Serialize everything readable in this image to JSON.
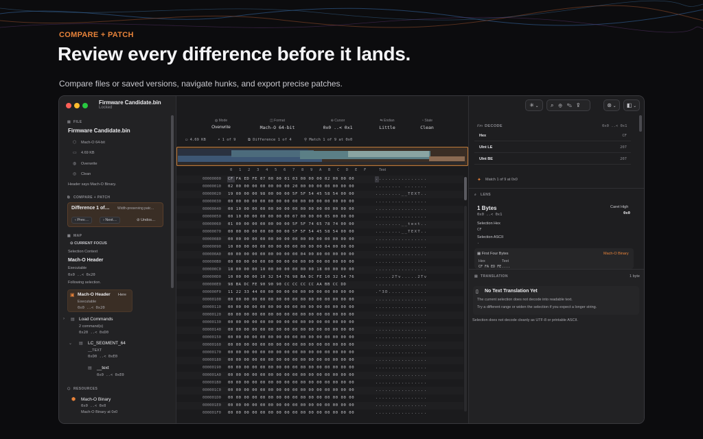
{
  "hero": {
    "kicker": "COMPARE + PATCH",
    "title": "Review every difference before it lands.",
    "subtitle": "Compare files or saved versions, navigate hunks, and export precise patches."
  },
  "colors": {
    "accent": "#e8833a",
    "window_bg": "#1b1b1d",
    "sidebar_bg": "#222224",
    "diff_highlight": "#3a2e25"
  },
  "window": {
    "doc_title": "Firmware Candidate.bin",
    "doc_subtitle": "Locked"
  },
  "sidebar": {
    "file_header": "FILE",
    "file_name": "Firmware Candidate.bin",
    "file_meta": [
      {
        "icon": "cube-icon",
        "text": "Mach-O 64-bit"
      },
      {
        "icon": "disk-icon",
        "text": "4.69 KB"
      },
      {
        "icon": "overwrite-icon",
        "text": "Overwrite"
      },
      {
        "icon": "check-icon",
        "text": "Clean"
      }
    ],
    "file_note": "Header says Mach-O Binary.",
    "compare_header": "COMPARE + PATCH",
    "compare_title": "Difference 1 of…",
    "compare_hint": "Width-preserving patc…",
    "prev_label": "Prev…",
    "next_label": "Next…",
    "undo_label": "Undos…",
    "map_header": "MAP",
    "current_focus": "CURRENT FOCUS",
    "selection_context_label": "Selection Context",
    "focus_title": "Mach-O Header",
    "focus_kind": "Executable",
    "focus_range": "0x0 ..< 0x20",
    "following": "Following selection.",
    "card_title": "Mach-O Header",
    "card_here": "Here",
    "card_kind": "Executable",
    "card_range": "0x0 ..< 0x20",
    "load_commands": "Load Commands",
    "load_commands_count": "2 command(s)",
    "load_commands_range": "0x20 ..< 0xD0",
    "segment": "LC_SEGMENT_64",
    "segment_name": "__TEXT",
    "segment_range": "0xD0 ..< 0xE0",
    "section": "__text",
    "section_range": "0x0 ..< 0xE0",
    "resources_header": "RESOURCES",
    "resource_title": "Mach-O Binary",
    "resource_range": "0x0 ..< 0x0",
    "resource_note": "Mach-O Binary at 0x0"
  },
  "infobar": [
    {
      "key": "Mode",
      "value": "Overwrite",
      "icon": "overwrite-icon"
    },
    {
      "key": "Format",
      "value": "Mach-O 64-bit",
      "icon": "format-icon"
    },
    {
      "key": "Cursor",
      "value": "0x0 ..< 0x1",
      "icon": "cursor-icon"
    },
    {
      "key": "Endian",
      "value": "Little",
      "icon": "endian-icon"
    },
    {
      "key": "State",
      "value": "Clean",
      "icon": "state-icon"
    }
  ],
  "status": {
    "size": "4.69 KB",
    "search": "1 of 9",
    "difference": "Difference 1 of 4",
    "match": "Match 1 of 9 at 0x0"
  },
  "hex": {
    "columns": [
      "0",
      "1",
      "2",
      "3",
      "4",
      "5",
      "6",
      "7",
      "8",
      "9",
      "A",
      "B",
      "C",
      "D",
      "E",
      "F"
    ],
    "text_header": "Text",
    "rows": [
      {
        "off": "00000000",
        "bytes": "CF FA ED FE 07 00 00 01 03 00 00 00 02 00 00 00",
        "ascii": "................"
      },
      {
        "off": "00000010",
        "bytes": "02 00 00 00 00 00 00 00 20 00 00 00 00 00 00 00",
        "ascii": "........ ......."
      },
      {
        "off": "00000020",
        "bytes": "19 00 00 00 98 00 00 00 5F 5F 54 45 58 54 00 00",
        "ascii": "........__TEXT.."
      },
      {
        "off": "00000030",
        "bytes": "00 00 00 00 00 00 00 00 00 00 00 00 00 00 00 00",
        "ascii": "................"
      },
      {
        "off": "00000040",
        "bytes": "00 10 00 00 00 00 00 00 00 00 00 00 00 00 00 00",
        "ascii": "................"
      },
      {
        "off": "00000050",
        "bytes": "00 10 00 00 00 00 00 00 07 00 00 00 05 00 00 00",
        "ascii": "................"
      },
      {
        "off": "00000060",
        "bytes": "01 00 00 00 00 00 00 00 5F 5F 74 65 78 74 00 00",
        "ascii": "........__text.."
      },
      {
        "off": "00000070",
        "bytes": "00 00 00 00 00 00 00 00 5F 5F 54 45 58 54 00 00",
        "ascii": "........__TEXT.."
      },
      {
        "off": "00000080",
        "bytes": "00 00 00 00 00 00 00 00 00 00 00 00 00 00 00 00",
        "ascii": "................"
      },
      {
        "off": "00000090",
        "bytes": "10 00 00 00 00 00 00 00 00 00 00 00 04 00 00 00",
        "ascii": "................"
      },
      {
        "off": "000000A0",
        "bytes": "00 00 00 00 00 00 00 00 00 04 00 80 00 00 00 00",
        "ascii": "................"
      },
      {
        "off": "000000B0",
        "bytes": "00 00 00 00 00 00 00 00 00 00 00 00 00 00 00 00",
        "ascii": "................"
      },
      {
        "off": "000000C0",
        "bytes": "18 00 00 00 10 00 00 00 00 00 00 18 00 00 00 00",
        "ascii": "................"
      },
      {
        "off": "000000D0",
        "bytes": "10 00 00 00 10 32 54 76 98 BA DC FE 10 32 54 76",
        "ascii": ".....2Tv.....2Tv"
      },
      {
        "off": "000000E0",
        "bytes": "98 BA DC FE 90 90 90 CC CC CC CC AA BB CC DD",
        "ascii": "................"
      },
      {
        "off": "000000F0",
        "bytes": "11 22 33 44 00 00 00 00 00 00 00 00 00 00 00 00",
        "ascii": ".\"3D............"
      },
      {
        "off": "00000100",
        "bytes": "00 00 00 00 00 00 00 00 00 00 00 00 00 00 00 00",
        "ascii": "................"
      },
      {
        "off": "00000110",
        "bytes": "00 00 00 00 00 00 00 00 00 00 00 00 00 00 00 00",
        "ascii": "................"
      },
      {
        "off": "00000120",
        "bytes": "00 00 00 00 00 00 00 00 00 00 00 00 00 00 00 00",
        "ascii": "................"
      },
      {
        "off": "00000130",
        "bytes": "00 00 00 00 00 00 00 00 00 00 00 00 00 00 00 00",
        "ascii": "................"
      },
      {
        "off": "00000140",
        "bytes": "00 00 00 00 00 00 00 00 00 00 00 00 00 00 00 00",
        "ascii": "................"
      },
      {
        "off": "00000150",
        "bytes": "00 00 00 00 00 00 00 00 00 00 00 00 00 00 00 00",
        "ascii": "................"
      },
      {
        "off": "00000160",
        "bytes": "00 00 00 00 00 00 00 00 00 00 00 00 00 00 00 00",
        "ascii": "................"
      },
      {
        "off": "00000170",
        "bytes": "00 00 00 00 00 00 00 00 00 00 00 00 00 00 00 00",
        "ascii": "................"
      },
      {
        "off": "00000180",
        "bytes": "00 00 00 00 00 00 00 00 00 00 00 00 00 00 00 00",
        "ascii": "................"
      },
      {
        "off": "00000190",
        "bytes": "00 00 00 00 00 00 00 00 00 00 00 00 00 00 00 00",
        "ascii": "................"
      },
      {
        "off": "000001A0",
        "bytes": "00 00 00 00 00 00 00 00 00 00 00 00 00 00 00 00",
        "ascii": "................"
      },
      {
        "off": "000001B0",
        "bytes": "00 00 00 00 00 00 00 00 00 00 00 00 00 00 00 00",
        "ascii": "................"
      },
      {
        "off": "000001C0",
        "bytes": "00 00 00 00 00 00 00 00 00 00 00 00 00 00 00 00",
        "ascii": "................"
      },
      {
        "off": "000001D0",
        "bytes": "00 00 00 00 00 00 00 00 00 00 00 00 00 00 00 00",
        "ascii": "................"
      },
      {
        "off": "000001E0",
        "bytes": "00 00 00 00 00 00 00 00 00 00 00 00 00 00 00 00",
        "ascii": "................"
      },
      {
        "off": "000001F0",
        "bytes": "00 00 00 00 00 00 00 00 00 00 00 00 00 00 00 00",
        "ascii": "................"
      }
    ]
  },
  "inspector": {
    "decode_header": "DECODE",
    "decode_prefix": "Fm",
    "decode_range": "0x0 ..< 0x1",
    "rows": [
      {
        "label": "Hex",
        "value": "CF"
      },
      {
        "label": "UInt LE",
        "value": "207"
      },
      {
        "label": "UInt BE",
        "value": "207"
      }
    ],
    "match_note": "Match 1 of 9 at 0x0",
    "lens_header": "LENS",
    "lens_bytes": "1 Bytes",
    "lens_range": "0x0 ..< 0x1",
    "caret_label": "Caret High",
    "caret_value": "0x0",
    "sel_hex_label": "Selection Hex",
    "sel_hex_value": "CF",
    "sel_ascii_label": "Selection ASCII",
    "sel_ascii_value": ".",
    "first_four_label": "First Four Bytes",
    "first_four_tag": "Mach-O Binary",
    "hex_col": "Hex",
    "text_col": "Text",
    "first_four_hex": "CF FA ED FE",
    "first_four_text": "...."
  },
  "translation": {
    "header": "TRANSLATION",
    "count": "1 byte",
    "title": "No Text Translation Yet",
    "line1": "The current selection does not decode into readable text.",
    "line2": "Try a different range or widen the selection if you expect a longer string.",
    "footer": "Selection does not decode cleanly as UTF-8 or printable ASCII."
  }
}
